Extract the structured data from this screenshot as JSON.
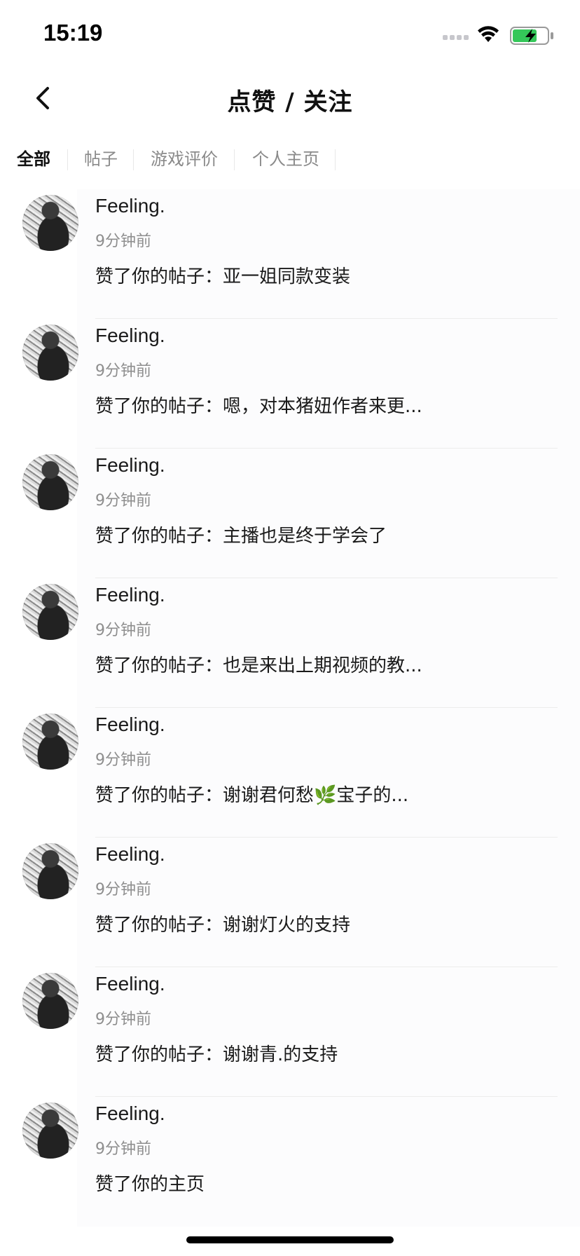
{
  "status_bar": {
    "time": "15:19",
    "signal_icon": "cellular-signal-icon",
    "wifi_icon": "wifi-icon",
    "battery_icon": "battery-charging-icon",
    "battery_color": "#34c759"
  },
  "nav": {
    "back_icon": "chevron-left-icon",
    "title": "点赞 / 关注"
  },
  "tabs": [
    {
      "label": "全部",
      "active": true
    },
    {
      "label": "帖子",
      "active": false
    },
    {
      "label": "游戏评价",
      "active": false
    },
    {
      "label": "个人主页",
      "active": false
    }
  ],
  "notifications": [
    {
      "name": "Feeling.",
      "time": "9分钟前",
      "content": "赞了你的帖子：亚一姐同款变装"
    },
    {
      "name": "Feeling.",
      "time": "9分钟前",
      "content": "赞了你的帖子：嗯，对本猪妞作者来更..."
    },
    {
      "name": "Feeling.",
      "time": "9分钟前",
      "content": "赞了你的帖子：主播也是终于学会了"
    },
    {
      "name": "Feeling.",
      "time": "9分钟前",
      "content": "赞了你的帖子：也是来出上期视频的教..."
    },
    {
      "name": "Feeling.",
      "time": "9分钟前",
      "content": "赞了你的帖子：谢谢君何愁🌿宝子的..."
    },
    {
      "name": "Feeling.",
      "time": "9分钟前",
      "content": "赞了你的帖子：谢谢灯火的支持"
    },
    {
      "name": "Feeling.",
      "time": "9分钟前",
      "content": "赞了你的帖子：谢谢青.的支持"
    },
    {
      "name": "Feeling.",
      "time": "9分钟前",
      "content": "赞了你的主页"
    }
  ]
}
